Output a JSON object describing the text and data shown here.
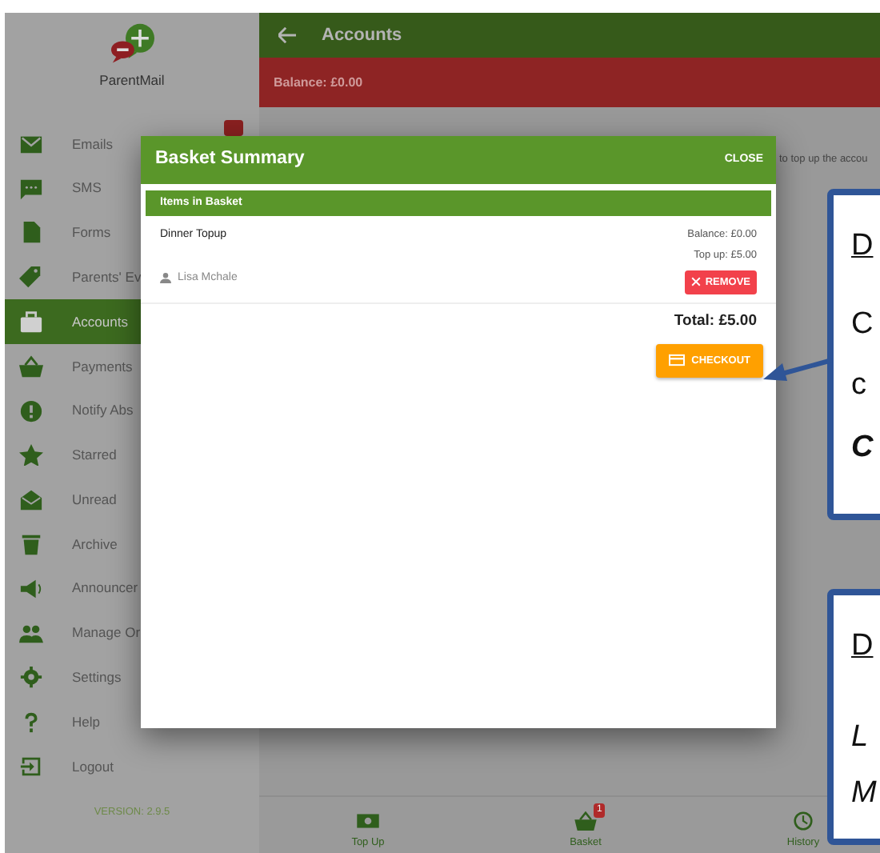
{
  "app": {
    "name": "ParentMail",
    "version": "VERSION: 2.9.5"
  },
  "sidebar": {
    "items": [
      {
        "label": "Emails",
        "selected": false,
        "badge": true
      },
      {
        "label": "SMS",
        "selected": false,
        "badge": false
      },
      {
        "label": "Forms",
        "selected": false,
        "badge": false
      },
      {
        "label": "Parents' Ev",
        "selected": false,
        "badge": false
      },
      {
        "label": "Accounts",
        "selected": true,
        "badge": false
      },
      {
        "label": "Payments",
        "selected": false,
        "badge": false
      },
      {
        "label": "Notify Abs",
        "selected": false,
        "badge": false
      },
      {
        "label": "Starred",
        "selected": false,
        "badge": false
      },
      {
        "label": "Unread",
        "selected": false,
        "badge": false
      },
      {
        "label": "Archive",
        "selected": false,
        "badge": false
      },
      {
        "label": "Announcer",
        "selected": false,
        "badge": false
      },
      {
        "label": "Manage Or",
        "selected": false,
        "badge": false
      },
      {
        "label": "Settings",
        "selected": false,
        "badge": false
      },
      {
        "label": "Help",
        "selected": false,
        "badge": false
      },
      {
        "label": "Logout",
        "selected": false,
        "badge": false
      }
    ]
  },
  "header": {
    "title": "Accounts"
  },
  "balance_bar": {
    "text": "Balance: £0.00"
  },
  "content": {
    "text": "to top up the accou"
  },
  "modal": {
    "title": "Basket Summary",
    "close": "CLOSE",
    "section": "Items in Basket",
    "items": [
      {
        "name": "Dinner Topup",
        "person": "Lisa Mchale",
        "balance": "Balance: £0.00",
        "topup": "Top up: £5.00",
        "remove": "REMOVE"
      }
    ],
    "total": "Total: £5.00",
    "checkout": "CHECKOUT"
  },
  "bottom_nav": [
    {
      "label": "Top Up"
    },
    {
      "label": "Basket",
      "count": "1"
    },
    {
      "label": "History"
    }
  ],
  "callouts": [
    {
      "lines": [
        {
          "text": "D",
          "kind": "underline"
        },
        {
          "text": "C",
          "kind": "plain"
        },
        {
          "text": "c",
          "kind": "plain"
        },
        {
          "text": "C",
          "kind": "emphasis"
        }
      ]
    },
    {
      "lines": [
        {
          "text": "D",
          "kind": "underline"
        },
        {
          "text": "L",
          "kind": "italic"
        },
        {
          "text": "M",
          "kind": "italic"
        }
      ]
    }
  ]
}
